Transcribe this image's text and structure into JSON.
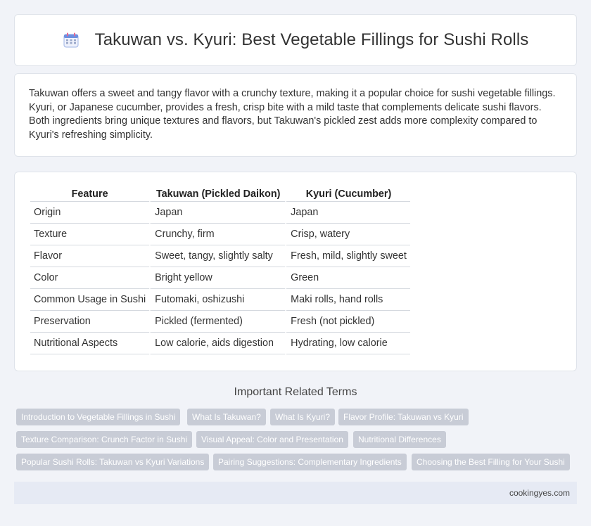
{
  "header": {
    "title": "Takuwan vs. Kyuri: Best Vegetable Fillings for Sushi Rolls",
    "icon": "calendar-icon"
  },
  "intro": {
    "text": "Takuwan offers a sweet and tangy flavor with a crunchy texture, making it a popular choice for sushi vegetable fillings. Kyuri, or Japanese cucumber, provides a fresh, crisp bite with a mild taste that complements delicate sushi flavors. Both ingredients bring unique textures and flavors, but Takuwan's pickled zest adds more complexity compared to Kyuri's refreshing simplicity."
  },
  "table": {
    "headers": [
      "Feature",
      "Takuwan (Pickled Daikon)",
      "Kyuri (Cucumber)"
    ],
    "rows": [
      [
        "Origin",
        "Japan",
        "Japan"
      ],
      [
        "Texture",
        "Crunchy, firm",
        "Crisp, watery"
      ],
      [
        "Flavor",
        "Sweet, tangy, slightly salty",
        "Fresh, mild, slightly sweet"
      ],
      [
        "Color",
        "Bright yellow",
        "Green"
      ],
      [
        "Common Usage in Sushi",
        "Futomaki, oshizushi",
        "Maki rolls, hand rolls"
      ],
      [
        "Preservation",
        "Pickled (fermented)",
        "Fresh (not pickled)"
      ],
      [
        "Nutritional Aspects",
        "Low calorie, aids digestion",
        "Hydrating, low calorie"
      ]
    ]
  },
  "related": {
    "title": "Important Related Terms",
    "tags": [
      "Introduction to Vegetable Fillings in Sushi",
      "What Is Takuwan?",
      "What Is Kyuri?",
      "Flavor Profile: Takuwan vs Kyuri",
      "Texture Comparison: Crunch Factor in Sushi",
      "Visual Appeal: Color and Presentation",
      "Nutritional Differences",
      "Popular Sushi Rolls: Takuwan vs Kyuri Variations",
      "Pairing Suggestions: Complementary Ingredients",
      "Choosing the Best Filling for Your Sushi"
    ]
  },
  "footer": {
    "site": "cookingyes.com"
  },
  "colors": {
    "background": "#f1f3f8",
    "card": "#ffffff",
    "tag": "#c8ccd6",
    "footer": "#e6eaf4",
    "icon_accent": "#5b8def"
  }
}
